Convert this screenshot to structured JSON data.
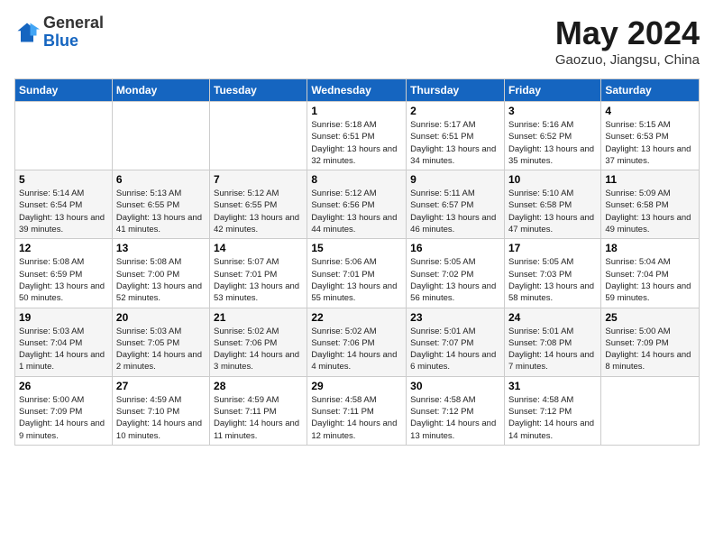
{
  "header": {
    "logo_line1": "General",
    "logo_line2": "Blue",
    "month_title": "May 2024",
    "subtitle": "Gaozuo, Jiangsu, China"
  },
  "weekdays": [
    "Sunday",
    "Monday",
    "Tuesday",
    "Wednesday",
    "Thursday",
    "Friday",
    "Saturday"
  ],
  "weeks": [
    [
      {
        "day": "",
        "info": ""
      },
      {
        "day": "",
        "info": ""
      },
      {
        "day": "",
        "info": ""
      },
      {
        "day": "1",
        "info": "Sunrise: 5:18 AM\nSunset: 6:51 PM\nDaylight: 13 hours and 32 minutes."
      },
      {
        "day": "2",
        "info": "Sunrise: 5:17 AM\nSunset: 6:51 PM\nDaylight: 13 hours and 34 minutes."
      },
      {
        "day": "3",
        "info": "Sunrise: 5:16 AM\nSunset: 6:52 PM\nDaylight: 13 hours and 35 minutes."
      },
      {
        "day": "4",
        "info": "Sunrise: 5:15 AM\nSunset: 6:53 PM\nDaylight: 13 hours and 37 minutes."
      }
    ],
    [
      {
        "day": "5",
        "info": "Sunrise: 5:14 AM\nSunset: 6:54 PM\nDaylight: 13 hours and 39 minutes."
      },
      {
        "day": "6",
        "info": "Sunrise: 5:13 AM\nSunset: 6:55 PM\nDaylight: 13 hours and 41 minutes."
      },
      {
        "day": "7",
        "info": "Sunrise: 5:12 AM\nSunset: 6:55 PM\nDaylight: 13 hours and 42 minutes."
      },
      {
        "day": "8",
        "info": "Sunrise: 5:12 AM\nSunset: 6:56 PM\nDaylight: 13 hours and 44 minutes."
      },
      {
        "day": "9",
        "info": "Sunrise: 5:11 AM\nSunset: 6:57 PM\nDaylight: 13 hours and 46 minutes."
      },
      {
        "day": "10",
        "info": "Sunrise: 5:10 AM\nSunset: 6:58 PM\nDaylight: 13 hours and 47 minutes."
      },
      {
        "day": "11",
        "info": "Sunrise: 5:09 AM\nSunset: 6:58 PM\nDaylight: 13 hours and 49 minutes."
      }
    ],
    [
      {
        "day": "12",
        "info": "Sunrise: 5:08 AM\nSunset: 6:59 PM\nDaylight: 13 hours and 50 minutes."
      },
      {
        "day": "13",
        "info": "Sunrise: 5:08 AM\nSunset: 7:00 PM\nDaylight: 13 hours and 52 minutes."
      },
      {
        "day": "14",
        "info": "Sunrise: 5:07 AM\nSunset: 7:01 PM\nDaylight: 13 hours and 53 minutes."
      },
      {
        "day": "15",
        "info": "Sunrise: 5:06 AM\nSunset: 7:01 PM\nDaylight: 13 hours and 55 minutes."
      },
      {
        "day": "16",
        "info": "Sunrise: 5:05 AM\nSunset: 7:02 PM\nDaylight: 13 hours and 56 minutes."
      },
      {
        "day": "17",
        "info": "Sunrise: 5:05 AM\nSunset: 7:03 PM\nDaylight: 13 hours and 58 minutes."
      },
      {
        "day": "18",
        "info": "Sunrise: 5:04 AM\nSunset: 7:04 PM\nDaylight: 13 hours and 59 minutes."
      }
    ],
    [
      {
        "day": "19",
        "info": "Sunrise: 5:03 AM\nSunset: 7:04 PM\nDaylight: 14 hours and 1 minute."
      },
      {
        "day": "20",
        "info": "Sunrise: 5:03 AM\nSunset: 7:05 PM\nDaylight: 14 hours and 2 minutes."
      },
      {
        "day": "21",
        "info": "Sunrise: 5:02 AM\nSunset: 7:06 PM\nDaylight: 14 hours and 3 minutes."
      },
      {
        "day": "22",
        "info": "Sunrise: 5:02 AM\nSunset: 7:06 PM\nDaylight: 14 hours and 4 minutes."
      },
      {
        "day": "23",
        "info": "Sunrise: 5:01 AM\nSunset: 7:07 PM\nDaylight: 14 hours and 6 minutes."
      },
      {
        "day": "24",
        "info": "Sunrise: 5:01 AM\nSunset: 7:08 PM\nDaylight: 14 hours and 7 minutes."
      },
      {
        "day": "25",
        "info": "Sunrise: 5:00 AM\nSunset: 7:09 PM\nDaylight: 14 hours and 8 minutes."
      }
    ],
    [
      {
        "day": "26",
        "info": "Sunrise: 5:00 AM\nSunset: 7:09 PM\nDaylight: 14 hours and 9 minutes."
      },
      {
        "day": "27",
        "info": "Sunrise: 4:59 AM\nSunset: 7:10 PM\nDaylight: 14 hours and 10 minutes."
      },
      {
        "day": "28",
        "info": "Sunrise: 4:59 AM\nSunset: 7:11 PM\nDaylight: 14 hours and 11 minutes."
      },
      {
        "day": "29",
        "info": "Sunrise: 4:58 AM\nSunset: 7:11 PM\nDaylight: 14 hours and 12 minutes."
      },
      {
        "day": "30",
        "info": "Sunrise: 4:58 AM\nSunset: 7:12 PM\nDaylight: 14 hours and 13 minutes."
      },
      {
        "day": "31",
        "info": "Sunrise: 4:58 AM\nSunset: 7:12 PM\nDaylight: 14 hours and 14 minutes."
      },
      {
        "day": "",
        "info": ""
      }
    ]
  ]
}
